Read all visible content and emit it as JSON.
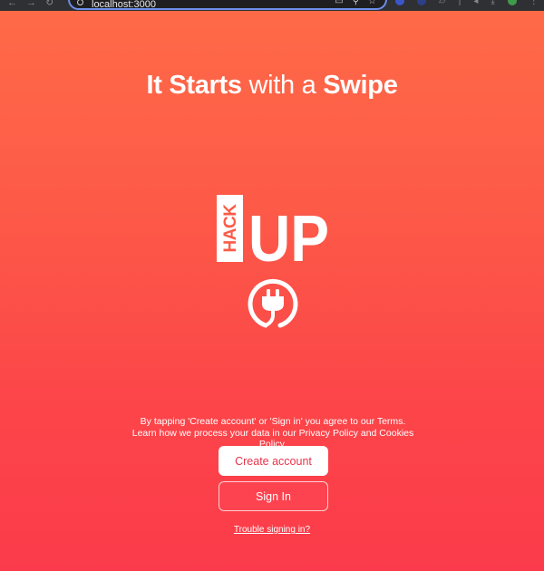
{
  "browser": {
    "url": "localhost:3000"
  },
  "headline": {
    "part1": "It Starts",
    "part2": " with a ",
    "part3": "Swipe"
  },
  "logo": {
    "small_text": "HACK",
    "large_text": "UP"
  },
  "terms_text": "By tapping 'Create account' or 'Sign in' you agree to our Terms. Learn how we process your data in our Privacy Policy and Cookies Policy.",
  "buttons": {
    "create_account": "Create account",
    "sign_in": "Sign In"
  },
  "trouble_link": "Trouble signing in?",
  "colors": {
    "gradient_top": "#fe6a47",
    "gradient_bottom": "#fb3b4b",
    "accent_text": "#e9344b"
  }
}
